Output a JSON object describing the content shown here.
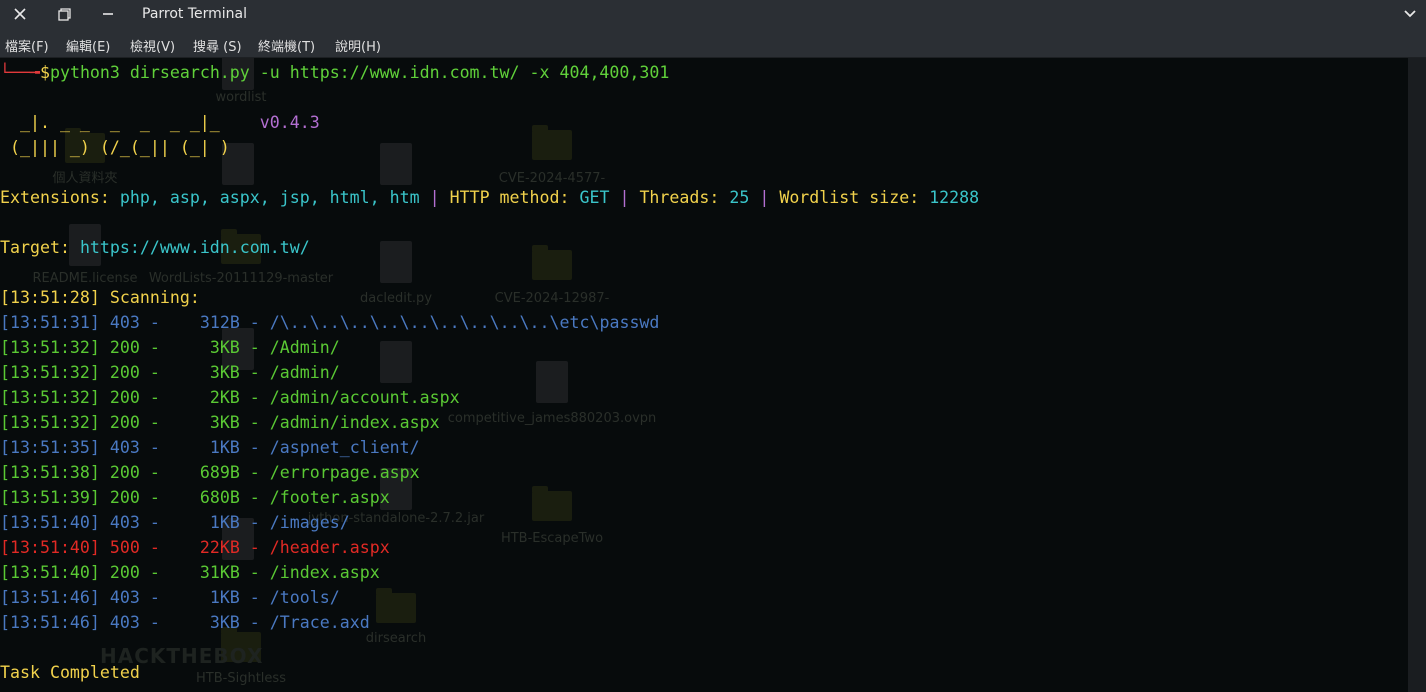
{
  "window": {
    "title": "Parrot Terminal",
    "menu": [
      "檔案(F)",
      "編輯(E)",
      "檢視(V)",
      "搜尋 (S)",
      "終端機(T)",
      "說明(H)"
    ]
  },
  "terminal": {
    "prompt_corner": "└──╼",
    "prompt_symbol": "$",
    "command": "python3 dirsearch.py -u https://www.idn.com.tw/ -x 404,400,301",
    "banner": {
      "line1": "  _|. _ _  _  _  _ _|_    ",
      "version": "v0.4.3",
      "line2": " (_||| _) (/_(_|| (_| )"
    },
    "config": {
      "ext_label": "Extensions: ",
      "ext_value": "php, asp, aspx, jsp, html, htm",
      "sep": " | ",
      "method_label": "HTTP method: ",
      "method_value": "GET",
      "threads_label": "Threads: ",
      "threads_value": "25",
      "wordlist_label": "Wordlist size: ",
      "wordlist_value": "12288"
    },
    "target": {
      "label": "Target: ",
      "url": "https://www.idn.com.tw/"
    },
    "scanning": {
      "time": "[13:51:28]",
      "label": " Scanning:"
    },
    "results": [
      {
        "time": "[13:51:31]",
        "status": "403",
        "size": "312B",
        "path": "/\\..\\..\\..\\..\\..\\..\\..\\..\\..\\etc\\passwd",
        "color": "blue"
      },
      {
        "time": "[13:51:32]",
        "status": "200",
        "size": "3KB",
        "path": "/Admin/",
        "color": "green"
      },
      {
        "time": "[13:51:32]",
        "status": "200",
        "size": "3KB",
        "path": "/admin/",
        "color": "green"
      },
      {
        "time": "[13:51:32]",
        "status": "200",
        "size": "2KB",
        "path": "/admin/account.aspx",
        "color": "green"
      },
      {
        "time": "[13:51:32]",
        "status": "200",
        "size": "3KB",
        "path": "/admin/index.aspx",
        "color": "green"
      },
      {
        "time": "[13:51:35]",
        "status": "403",
        "size": "1KB",
        "path": "/aspnet_client/",
        "color": "blue"
      },
      {
        "time": "[13:51:38]",
        "status": "200",
        "size": "689B",
        "path": "/errorpage.aspx",
        "color": "green"
      },
      {
        "time": "[13:51:39]",
        "status": "200",
        "size": "680B",
        "path": "/footer.aspx",
        "color": "green"
      },
      {
        "time": "[13:51:40]",
        "status": "403",
        "size": "1KB",
        "path": "/images/",
        "color": "blue"
      },
      {
        "time": "[13:51:40]",
        "status": "500",
        "size": "22KB",
        "path": "/header.aspx",
        "color": "red"
      },
      {
        "time": "[13:51:40]",
        "status": "200",
        "size": "31KB",
        "path": "/index.aspx",
        "color": "green"
      },
      {
        "time": "[13:51:46]",
        "status": "403",
        "size": "1KB",
        "path": "/tools/",
        "color": "blue"
      },
      {
        "time": "[13:51:46]",
        "status": "403",
        "size": "3KB",
        "path": "/Trace.axd",
        "color": "blue"
      }
    ],
    "completed": "Task Completed"
  },
  "desktop_icons": [
    "wordlist",
    "個人資料夾",
    "README.license",
    "WordLists-20111129-master",
    "dacledit.py",
    "CVE-2024-4577-",
    "CVE-2024-12987-",
    "competitive_james880203.ovpn",
    "jython-standalone-2.7.2.jar",
    "HTB-EscapeTwo",
    "dirsearch",
    "HTB-Sightless"
  ],
  "colors": {
    "background": "#070b0c",
    "green": "#5ac934",
    "yellow": "#f1d24c",
    "cyan": "#3ac5ca",
    "blue": "#4a79c2",
    "red": "#e12a25"
  }
}
